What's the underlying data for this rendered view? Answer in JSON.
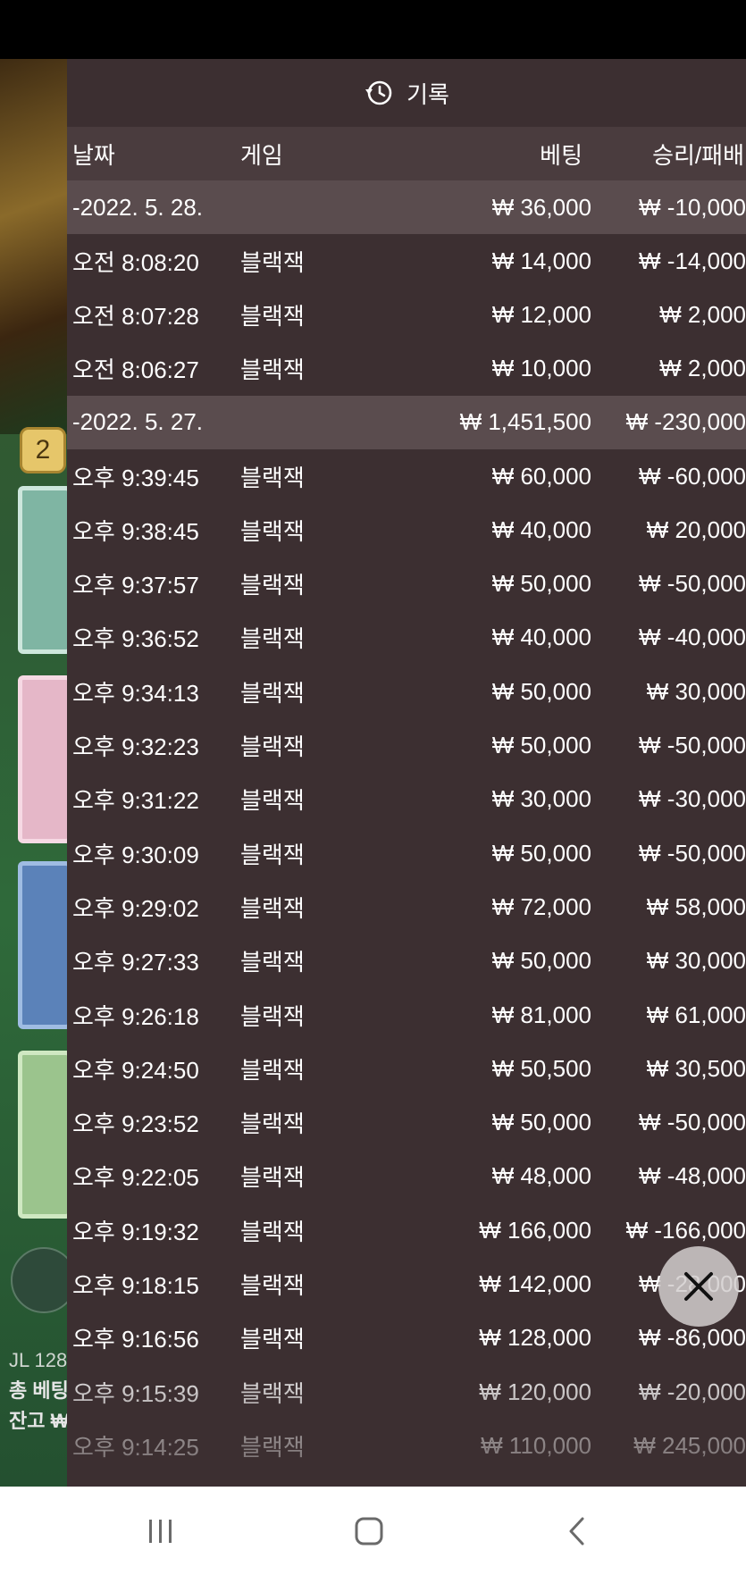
{
  "panel": {
    "title": "기록",
    "icon": "history-icon"
  },
  "columns": {
    "date": "날짜",
    "game": "게임",
    "bet": "베팅",
    "result": "승리/패배"
  },
  "groups": [
    {
      "date": "-2022. 5. 28.",
      "bet": "₩ 36,000",
      "result": "₩ -10,000",
      "rows": [
        {
          "time": "오전 8:08:20",
          "game": "블랙잭",
          "bet": "₩ 14,000",
          "result": "₩ -14,000"
        },
        {
          "time": "오전 8:07:28",
          "game": "블랙잭",
          "bet": "₩ 12,000",
          "result": "₩ 2,000"
        },
        {
          "time": "오전 8:06:27",
          "game": "블랙잭",
          "bet": "₩ 10,000",
          "result": "₩ 2,000"
        }
      ]
    },
    {
      "date": "-2022. 5. 27.",
      "bet": "₩ 1,451,500",
      "result": "₩ -230,000",
      "rows": [
        {
          "time": "오후 9:39:45",
          "game": "블랙잭",
          "bet": "₩ 60,000",
          "result": "₩ -60,000"
        },
        {
          "time": "오후 9:38:45",
          "game": "블랙잭",
          "bet": "₩ 40,000",
          "result": "₩ 20,000"
        },
        {
          "time": "오후 9:37:57",
          "game": "블랙잭",
          "bet": "₩ 50,000",
          "result": "₩ -50,000"
        },
        {
          "time": "오후 9:36:52",
          "game": "블랙잭",
          "bet": "₩ 40,000",
          "result": "₩ -40,000"
        },
        {
          "time": "오후 9:34:13",
          "game": "블랙잭",
          "bet": "₩ 50,000",
          "result": "₩ 30,000"
        },
        {
          "time": "오후 9:32:23",
          "game": "블랙잭",
          "bet": "₩ 50,000",
          "result": "₩ -50,000"
        },
        {
          "time": "오후 9:31:22",
          "game": "블랙잭",
          "bet": "₩ 30,000",
          "result": "₩ -30,000"
        },
        {
          "time": "오후 9:30:09",
          "game": "블랙잭",
          "bet": "₩ 50,000",
          "result": "₩ -50,000"
        },
        {
          "time": "오후 9:29:02",
          "game": "블랙잭",
          "bet": "₩ 72,000",
          "result": "₩ 58,000"
        },
        {
          "time": "오후 9:27:33",
          "game": "블랙잭",
          "bet": "₩ 50,000",
          "result": "₩ 30,000"
        },
        {
          "time": "오후 9:26:18",
          "game": "블랙잭",
          "bet": "₩ 81,000",
          "result": "₩ 61,000"
        },
        {
          "time": "오후 9:24:50",
          "game": "블랙잭",
          "bet": "₩ 50,500",
          "result": "₩ 30,500"
        },
        {
          "time": "오후 9:23:52",
          "game": "블랙잭",
          "bet": "₩ 50,000",
          "result": "₩ -50,000"
        },
        {
          "time": "오후 9:22:05",
          "game": "블랙잭",
          "bet": "₩ 48,000",
          "result": "₩ -48,000"
        },
        {
          "time": "오후 9:19:32",
          "game": "블랙잭",
          "bet": "₩ 166,000",
          "result": "₩ -166,000"
        },
        {
          "time": "오후 9:18:15",
          "game": "블랙잭",
          "bet": "₩ 142,000",
          "result": "₩ -28,000"
        },
        {
          "time": "오후 9:16:56",
          "game": "블랙잭",
          "bet": "₩ 128,000",
          "result": "₩ -86,000"
        },
        {
          "time": "오후 9:15:39",
          "game": "블랙잭",
          "bet": "₩ 120,000",
          "result": "₩ -20,000"
        },
        {
          "time": "오후 9:14:25",
          "game": "블랙잭",
          "bet": "₩ 110,000",
          "result": "₩ 245,000"
        }
      ]
    }
  ],
  "background": {
    "badge": "2",
    "line1": "JL 128",
    "line2": "총 베팅",
    "line3": "잔고 ₩"
  },
  "close_icon": "close-icon",
  "nav": {
    "recents": "recents-icon",
    "home": "home-icon",
    "back": "back-icon"
  }
}
